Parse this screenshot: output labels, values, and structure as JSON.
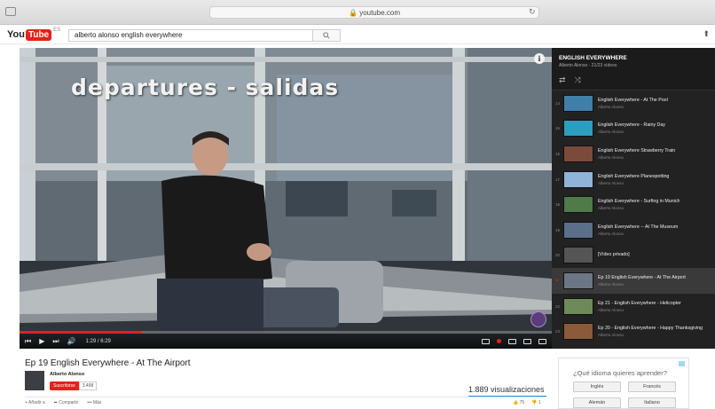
{
  "browser": {
    "url": "youtube.com"
  },
  "header": {
    "logo_you": "You",
    "logo_tube": "Tube",
    "region": "ES",
    "search_value": "alberto alonso english everywhere"
  },
  "player": {
    "overlay_title": "departures - salidas",
    "current_time": "1:29 / 6:29",
    "progress": 0.23,
    "accent_color": "#e62117"
  },
  "playlist": {
    "title": "ENGLISH EVERYWHERE",
    "subtitle": "Alberto Alonso - 21/23 vídeos",
    "items": [
      {
        "index": "14",
        "title": "English Everywhere - At The Pool",
        "author": "Alberto Alonso",
        "thumb": "#3f7fa8"
      },
      {
        "index": "15",
        "title": "English Everywhere - Rainy Day",
        "author": "Alberto Alonso",
        "thumb": "#2e9ec0"
      },
      {
        "index": "16",
        "title": "English Everywhere Strawberry Train",
        "author": "Alberto Alonso",
        "thumb": "#7a4a3a"
      },
      {
        "index": "17",
        "title": "English Everywhere Planespotting",
        "author": "Alberto Alonso",
        "thumb": "#8fb4d8"
      },
      {
        "index": "18",
        "title": "English Everywhere - Surfing in Munich",
        "author": "Alberto Alonso",
        "thumb": "#4f7a4a"
      },
      {
        "index": "19",
        "title": "English Everywhere -- At The Museum",
        "author": "Alberto Alonso",
        "thumb": "#5a6f8a"
      },
      {
        "index": "20",
        "title": "[Vídeo privado]",
        "author": "",
        "thumb": "#555555"
      },
      {
        "index": "▸",
        "title": "Ep 19 English Everywhere - At The Airport",
        "author": "Alberto Alonso",
        "thumb": "#6b7785",
        "active": true
      },
      {
        "index": "22",
        "title": "Ep 21 - English Everywhere - Helicopter",
        "author": "Alberto Alonso",
        "thumb": "#6f8a5a"
      },
      {
        "index": "23",
        "title": "Ep 20 - English Everywhere - Happy Thanksgiving",
        "author": "Alberto Alonso",
        "thumb": "#8a5a3a"
      }
    ]
  },
  "video": {
    "title": "Ep 19 English Everywhere - At The Airport",
    "channel": "Alberto Alonso",
    "subscribe_label": "Suscribirse",
    "subscriber_count": "3.498",
    "views": "1.889 visualizaciones",
    "add_label": "Añadir a",
    "share_label": "Compartir",
    "more_label": "Más",
    "likes": "75",
    "dislikes": "1"
  },
  "ad": {
    "question": "¿Qué idioma quieres aprender?",
    "languages": [
      "Inglés",
      "Francés",
      "Alemán",
      "Italiano"
    ]
  }
}
